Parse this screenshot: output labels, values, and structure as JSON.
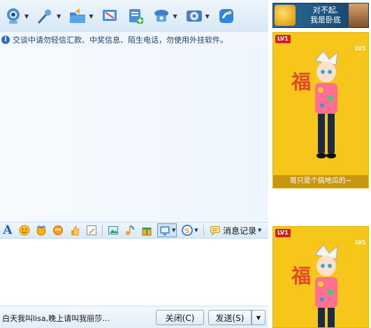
{
  "toolbar": {
    "buttons": [
      {
        "icon": "video-chat-icon",
        "dropdown": true
      },
      {
        "icon": "microphone-icon",
        "dropdown": true
      },
      {
        "icon": "file-transfer-icon",
        "dropdown": true
      },
      {
        "icon": "screenshot-icon",
        "dropdown": false
      },
      {
        "icon": "application-icon",
        "dropdown": false
      },
      {
        "icon": "remote-assist-icon",
        "dropdown": true
      },
      {
        "icon": "settings-icon",
        "dropdown": true
      },
      {
        "icon": "app-box-icon",
        "dropdown": false
      }
    ]
  },
  "notice": {
    "text": "交谈中请勿轻信汇款、中奖信息、陌生电话，勿使用外挂软件。"
  },
  "input_toolbar": {
    "history_label": "消息记录"
  },
  "bottom_bar": {
    "status_text": "白天我叫lisa,晚上请叫我丽莎...",
    "close_label": "关闭(C)",
    "send_label": "发送(S)"
  },
  "ad": {
    "text_line1": "对不起,",
    "text_line2": "我是卧底"
  },
  "show_panel": {
    "level_badge": "LV1",
    "level_label": "LV1",
    "caption": "哥只是个搞地瓜的~"
  },
  "colors": {
    "accent": "#2d6cc0",
    "toolbar_bg": "#d7e8f6",
    "show_bg": "#f6c61a"
  }
}
